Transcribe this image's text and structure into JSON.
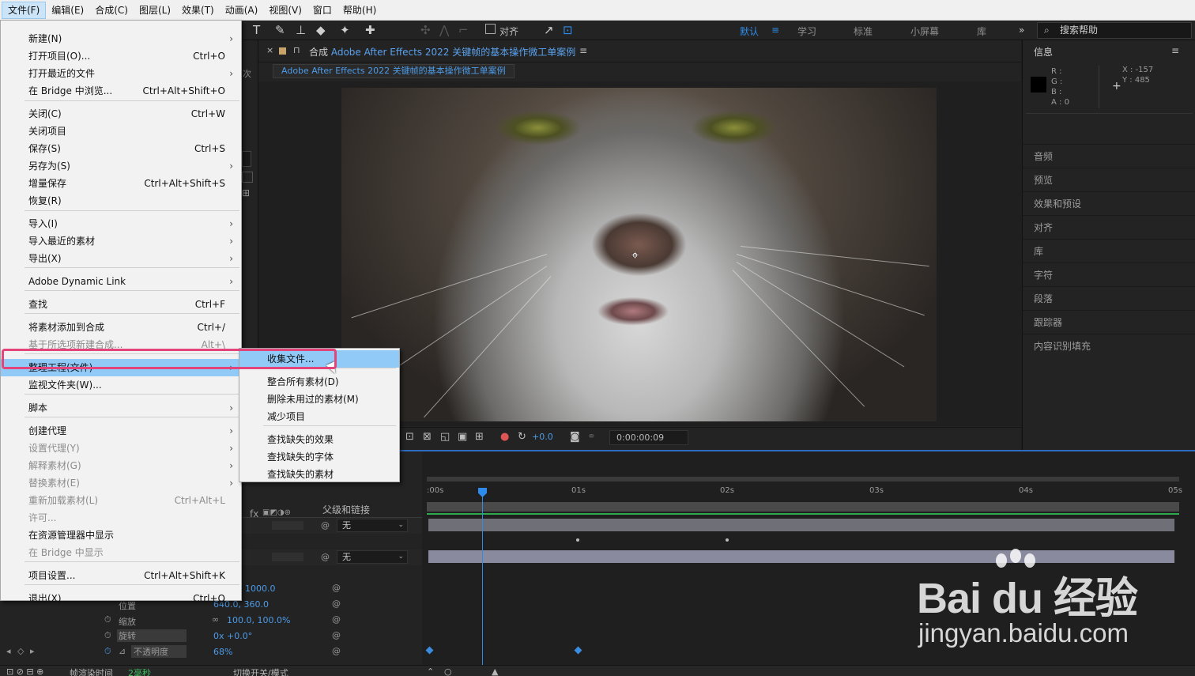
{
  "menubar": {
    "items": [
      "文件(F)",
      "编辑(E)",
      "合成(C)",
      "图层(L)",
      "效果(T)",
      "动画(A)",
      "视图(V)",
      "窗口",
      "帮助(H)"
    ]
  },
  "toolbar": {
    "snap_label": "对齐",
    "workspaces": [
      "默认",
      "学习",
      "标准",
      "小屏幕",
      "库"
    ],
    "search_placeholder": "搜索帮助"
  },
  "left_panel": {
    "fragment_text": "次"
  },
  "comp": {
    "tab_prefix": "合成",
    "tab_name": "Adobe After Effects 2022 关键帧的基本操作微工单案例",
    "breadcrumb": "Adobe After Effects 2022 关键帧的基本操作微工单案例",
    "exposure": "+0.0",
    "timecode": "0:00:00:09"
  },
  "info": {
    "title": "信息",
    "r": "R :",
    "g": "G :",
    "b": "B :",
    "a": "A : 0",
    "x": "X : -157",
    "y": "Y : 485"
  },
  "right_panels": [
    "音频",
    "预览",
    "效果和预设",
    "对齐",
    "库",
    "字符",
    "段落",
    "跟踪器",
    "内容识别填充"
  ],
  "timeline": {
    "ruler_labels": [
      ":00s",
      "01s",
      "02s",
      "03s",
      "04s",
      "05s"
    ],
    "parent_header": "父级和链接",
    "parent_none_1": "无",
    "parent_none_2": "无",
    "anchor_value": "1000.0",
    "position_label": "位置",
    "position_value": "640.0, 360.0",
    "scale_label": "缩放",
    "scale_value": "100.0, 100.0%",
    "rotation_label": "旋转",
    "rotation_value": "0x +0.0°",
    "opacity_label": "不透明度",
    "opacity_value": "68%"
  },
  "status_bar": {
    "render_label": "帧渲染时间",
    "render_value": "2毫秒",
    "toggle_label": "切换开关/模式"
  },
  "file_menu": {
    "items": [
      {
        "label": "新建(N)",
        "shortcut": "",
        "submenu": true,
        "disabled": false
      },
      {
        "label": "打开项目(O)...",
        "shortcut": "Ctrl+O",
        "submenu": false,
        "disabled": false
      },
      {
        "label": "打开最近的文件",
        "shortcut": "",
        "submenu": true,
        "disabled": false
      },
      {
        "label": "在 Bridge 中浏览...",
        "shortcut": "Ctrl+Alt+Shift+O",
        "submenu": false,
        "disabled": false
      },
      {
        "label": "关闭(C)",
        "shortcut": "Ctrl+W",
        "submenu": false,
        "disabled": false
      },
      {
        "label": "关闭项目",
        "shortcut": "",
        "submenu": false,
        "disabled": false
      },
      {
        "label": "保存(S)",
        "shortcut": "Ctrl+S",
        "submenu": false,
        "disabled": false
      },
      {
        "label": "另存为(S)",
        "shortcut": "",
        "submenu": true,
        "disabled": false
      },
      {
        "label": "增量保存",
        "shortcut": "Ctrl+Alt+Shift+S",
        "submenu": false,
        "disabled": false
      },
      {
        "label": "恢复(R)",
        "shortcut": "",
        "submenu": false,
        "disabled": false
      },
      {
        "label": "导入(I)",
        "shortcut": "",
        "submenu": true,
        "disabled": false
      },
      {
        "label": "导入最近的素材",
        "shortcut": "",
        "submenu": true,
        "disabled": false
      },
      {
        "label": "导出(X)",
        "shortcut": "",
        "submenu": true,
        "disabled": false
      },
      {
        "label": "Adobe Dynamic Link",
        "shortcut": "",
        "submenu": true,
        "disabled": false
      },
      {
        "label": "查找",
        "shortcut": "Ctrl+F",
        "submenu": false,
        "disabled": false
      },
      {
        "label": "将素材添加到合成",
        "shortcut": "Ctrl+/",
        "submenu": false,
        "disabled": false
      },
      {
        "label": "基于所选项新建合成...",
        "shortcut": "Alt+\\",
        "submenu": false,
        "disabled": true
      },
      {
        "label": "整理工程(文件)",
        "shortcut": "",
        "submenu": true,
        "disabled": false
      },
      {
        "label": "监视文件夹(W)...",
        "shortcut": "",
        "submenu": false,
        "disabled": false
      },
      {
        "label": "脚本",
        "shortcut": "",
        "submenu": true,
        "disabled": false
      },
      {
        "label": "创建代理",
        "shortcut": "",
        "submenu": true,
        "disabled": false
      },
      {
        "label": "设置代理(Y)",
        "shortcut": "",
        "submenu": true,
        "disabled": true
      },
      {
        "label": "解释素材(G)",
        "shortcut": "",
        "submenu": true,
        "disabled": true
      },
      {
        "label": "替换素材(E)",
        "shortcut": "",
        "submenu": true,
        "disabled": true
      },
      {
        "label": "重新加载素材(L)",
        "shortcut": "Ctrl+Alt+L",
        "submenu": false,
        "disabled": true
      },
      {
        "label": "许可...",
        "shortcut": "",
        "submenu": false,
        "disabled": true
      },
      {
        "label": "在资源管理器中显示",
        "shortcut": "",
        "submenu": false,
        "disabled": false
      },
      {
        "label": "在 Bridge 中显示",
        "shortcut": "",
        "submenu": false,
        "disabled": true
      },
      {
        "label": "项目设置...",
        "shortcut": "Ctrl+Alt+Shift+K",
        "submenu": false,
        "disabled": false
      },
      {
        "label": "退出(X)",
        "shortcut": "Ctrl+Q",
        "submenu": false,
        "disabled": false
      }
    ]
  },
  "sub_menu": {
    "items": [
      "收集文件...",
      "整合所有素材(D)",
      "删除未用过的素材(M)",
      "减少项目",
      "查找缺失的效果",
      "查找缺失的字体",
      "查找缺失的素材"
    ]
  },
  "watermark": {
    "brand": "Bai du 经验",
    "url": "jingyan.baidu.com"
  },
  "colors": {
    "accent": "#2d8ceb",
    "menu_highlight": "#91c9f7",
    "outline": "#e3447a",
    "layer_bar": "#8a8a9e",
    "green_line": "#2fa84f"
  }
}
